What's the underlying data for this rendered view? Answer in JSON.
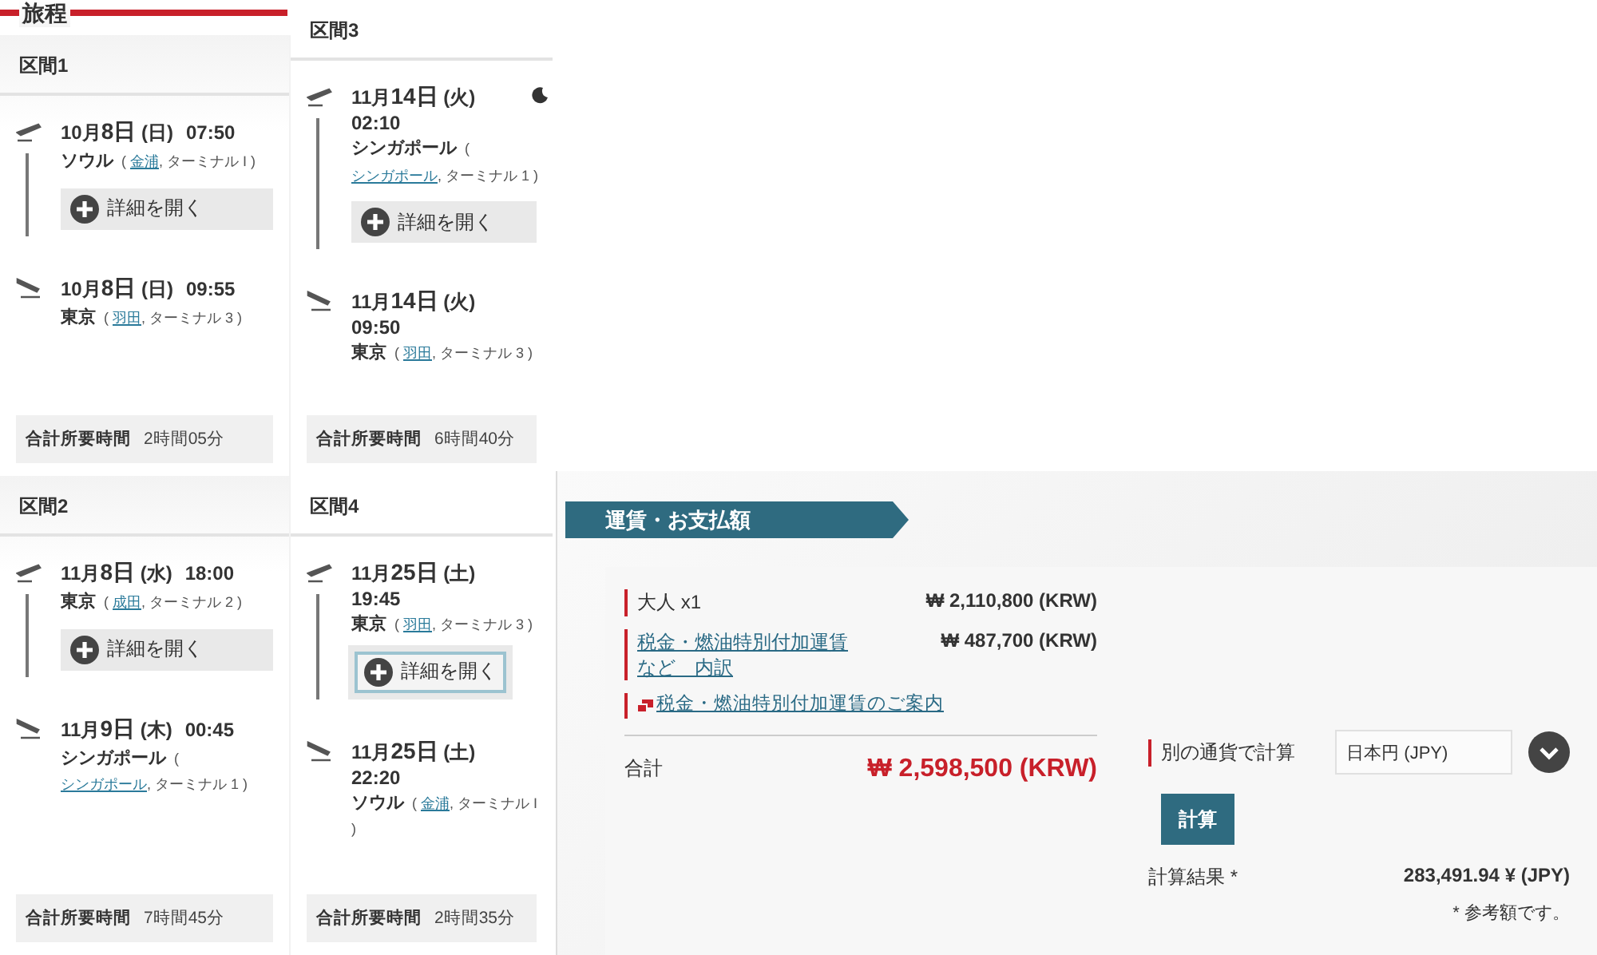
{
  "itinerary": {
    "title": "旅程",
    "segments": [
      {
        "label": "区間1",
        "departure": {
          "month": "10月",
          "day": "8日",
          "weekday": "(日)",
          "time": "07:50",
          "overnight": false,
          "city": "ソウル",
          "note_before": "(",
          "airport": "金浦",
          "note_after": ", ターミナル I )"
        },
        "details": {
          "label": "詳細を開く",
          "focused": false
        },
        "arrival": {
          "month": "10月",
          "day": "8日",
          "weekday": "(日)",
          "time": "09:55",
          "overnight": false,
          "city": "東京",
          "note_before": "(",
          "airport": "羽田",
          "note_after": ", ターミナル 3 )"
        },
        "duration_label": "合計所要時間",
        "duration": "2時間05分"
      },
      {
        "label": "区間2",
        "departure": {
          "month": "11月",
          "day": "8日",
          "weekday": "(水)",
          "time": "18:00",
          "overnight": false,
          "city": "東京",
          "note_before": "(",
          "airport": "成田",
          "note_after": ", ターミナル 2 )"
        },
        "details": {
          "label": "詳細を開く",
          "focused": false
        },
        "arrival": {
          "month": "11月",
          "day": "9日",
          "weekday": "(木)",
          "time": "00:45",
          "overnight": false,
          "city": "シンガポール",
          "note_before": "(",
          "airport": "シンガポール",
          "note_after": ", ターミナル 1 )"
        },
        "duration_label": "合計所要時間",
        "duration": "7時間45分"
      },
      {
        "label": "区間3",
        "departure": {
          "month": "11月",
          "day": "14日",
          "weekday": "(火)",
          "time": "02:10",
          "overnight": true,
          "city": "シンガポール",
          "note_before": "(",
          "airport": "シンガポール",
          "note_after": ", ターミナル 1 )"
        },
        "details": {
          "label": "詳細を開く",
          "focused": false
        },
        "arrival": {
          "month": "11月",
          "day": "14日",
          "weekday": "(火)",
          "time": "09:50",
          "overnight": false,
          "city": "東京",
          "note_before": "(",
          "airport": "羽田",
          "note_after": ", ターミナル 3 )"
        },
        "duration_label": "合計所要時間",
        "duration": "6時間40分"
      },
      {
        "label": "区間4",
        "departure": {
          "month": "11月",
          "day": "25日",
          "weekday": "(土)",
          "time": "19:45",
          "overnight": false,
          "city": "東京",
          "note_before": "(",
          "airport": "羽田",
          "note_after": ", ターミナル 3 )"
        },
        "details": {
          "label": "詳細を開く",
          "focused": true
        },
        "arrival": {
          "month": "11月",
          "day": "25日",
          "weekday": "(土)",
          "time": "22:20",
          "overnight": false,
          "city": "ソウル",
          "note_before": "(",
          "airport": "金浦",
          "note_after": ", ターミナル I )"
        },
        "duration_label": "合計所要時間",
        "duration": "2時間35分"
      }
    ]
  },
  "fare": {
    "title": "運賃・お支払額",
    "rows": [
      {
        "kind": "plain",
        "label": "大人 x1",
        "amount": "₩ 2,110,800 (KRW)"
      },
      {
        "kind": "link",
        "label": "税金・燃油特別付加運賃など　内訳",
        "amount": "₩ 487,700 (KRW)"
      },
      {
        "kind": "popup-link",
        "label": "税金・燃油特別付加運賃のご案内"
      }
    ],
    "total_label": "合計",
    "total": "₩ 2,598,500 (KRW)",
    "converter": {
      "label": "別の通貨で計算",
      "currency": "日本円 (JPY)",
      "button": "計算",
      "result_label": "計算結果 *",
      "result": "283,491.94 ¥ (JPY)",
      "note": "* 参考額です。"
    }
  }
}
